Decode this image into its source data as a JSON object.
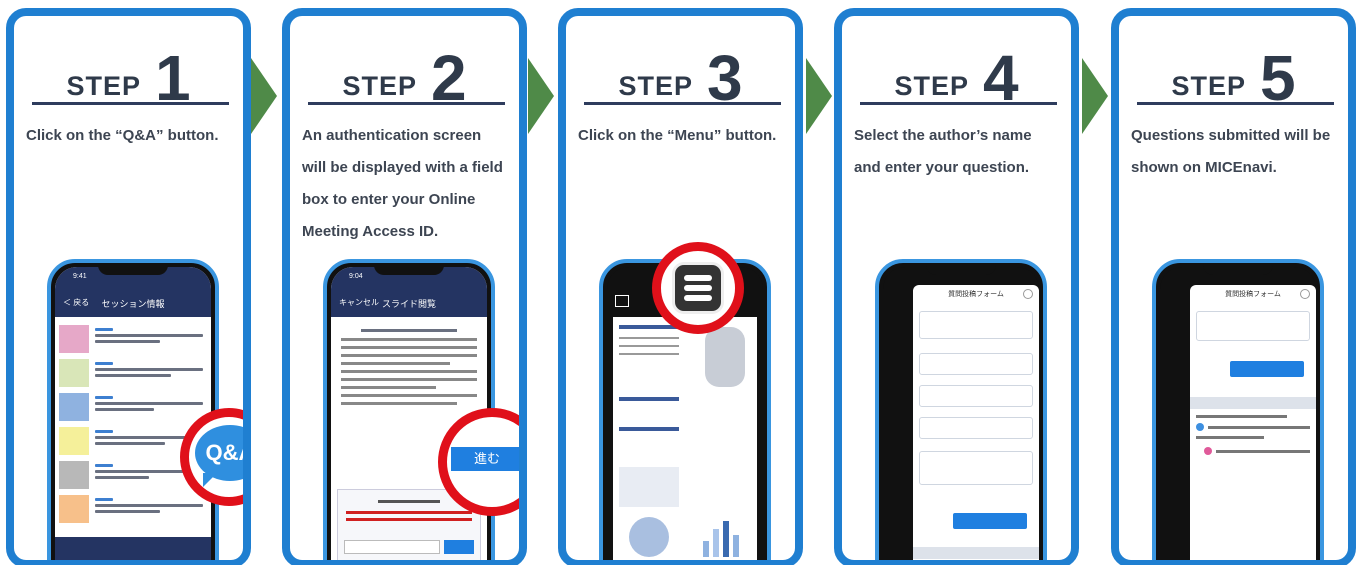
{
  "steps": [
    {
      "word": "STEP",
      "num": "1",
      "desc": "Click on the “Q&A” button."
    },
    {
      "word": "STEP",
      "num": "2",
      "desc": "An authentication screen will be displayed with a field box to enter your Online Meeting Access ID."
    },
    {
      "word": "STEP",
      "num": "3",
      "desc": "Click on the “Menu” button."
    },
    {
      "word": "STEP",
      "num": "4",
      "desc": "Select the author’s name and enter your question."
    },
    {
      "word": "STEP",
      "num": "5",
      "desc": "Questions submitted will be shown on MICEnavi."
    }
  ],
  "phone1": {
    "time": "9:41",
    "back": "＜ 戻る",
    "title": "セッション情報",
    "qa_label": "Q&A"
  },
  "phone2": {
    "time": "9:04",
    "cancel": "キャンセル",
    "title": "スライド閲覧",
    "go_label": "進む"
  },
  "phone4": {
    "title": "質問投稿フォーム"
  },
  "phone5": {
    "title": "質問投稿フォーム"
  },
  "colors": {
    "accent": "#1f7fd1",
    "arrow": "#4f8a48",
    "highlight": "#e0101a",
    "navy": "#243462"
  }
}
